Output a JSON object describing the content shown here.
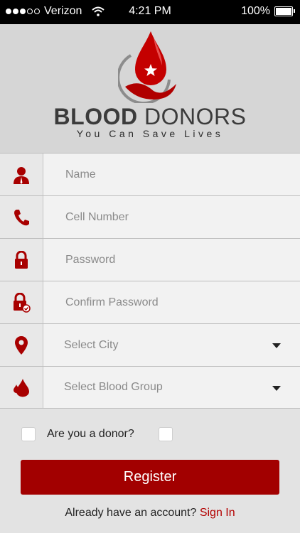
{
  "status_bar": {
    "carrier": "Verizon",
    "time": "4:21 PM",
    "battery": "100%"
  },
  "brand": {
    "name_bold": "BLOOD",
    "name_rest": " DONORS",
    "tagline": "You Can Save Lives"
  },
  "form": {
    "name": {
      "placeholder": "Name",
      "icon": "user-icon"
    },
    "cell": {
      "placeholder": "Cell Number",
      "icon": "phone-icon"
    },
    "password": {
      "placeholder": "Password",
      "icon": "lock-icon"
    },
    "confirm": {
      "placeholder": "Confirm Password",
      "icon": "lock-check-icon"
    },
    "city": {
      "value": "Select City",
      "icon": "location-pin-icon"
    },
    "blood_group": {
      "value": "Select Blood Group",
      "icon": "blood-drop-icon"
    }
  },
  "donor_check": {
    "label": "Are you a donor?"
  },
  "register_label": "Register",
  "signin": {
    "prompt": "Already have an account? ",
    "link": "Sign In"
  },
  "colors": {
    "accent": "#a20000",
    "icon": "#a80000",
    "header_bg": "#d6d6d6"
  }
}
